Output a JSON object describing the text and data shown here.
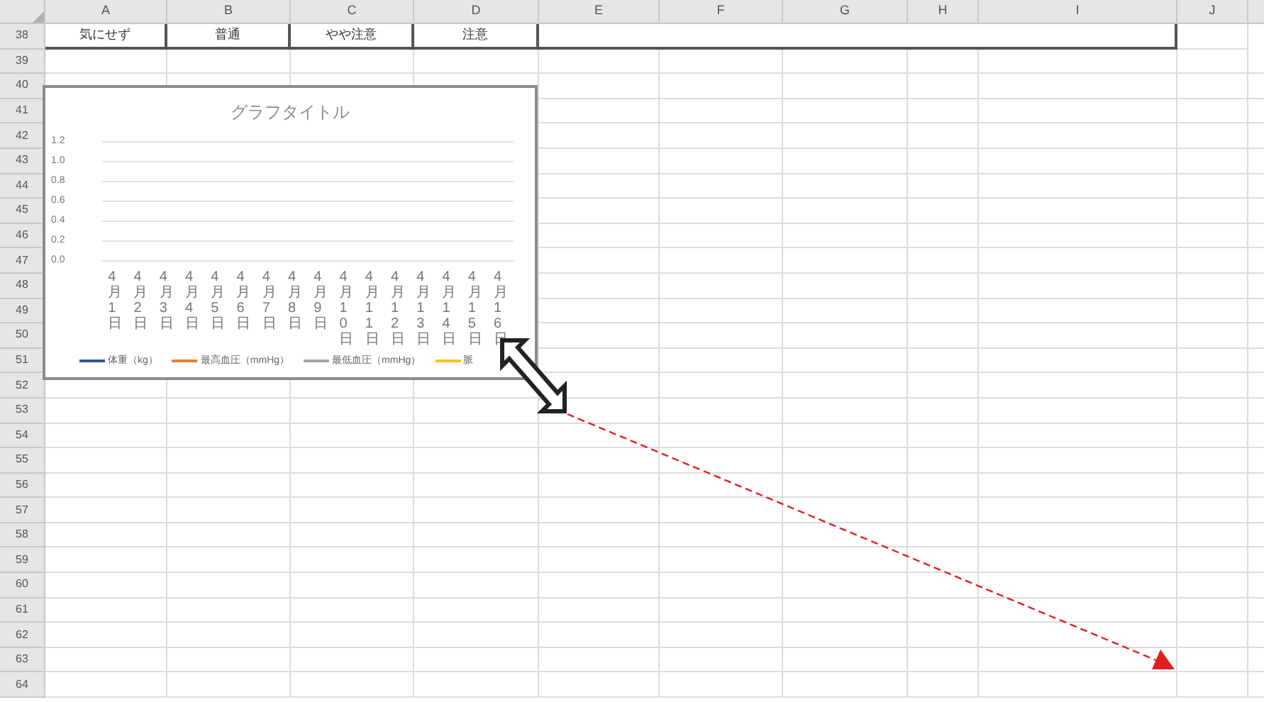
{
  "columns": [
    "A",
    "B",
    "C",
    "D",
    "E",
    "F",
    "G",
    "H",
    "I",
    "J"
  ],
  "rows": [
    "38",
    "39",
    "40",
    "41",
    "42",
    "43",
    "44",
    "45",
    "46",
    "47",
    "48",
    "49",
    "50",
    "51",
    "52",
    "53",
    "54",
    "55",
    "56",
    "57",
    "58",
    "59",
    "60",
    "61",
    "62",
    "63",
    "64"
  ],
  "header_row_cells": [
    "気にせず",
    "普通",
    "やや注意",
    "注意"
  ],
  "chart": {
    "chart_data": {
      "type": "line",
      "title": "グラフタイトル",
      "categories": [
        "4月1日",
        "4月2日",
        "4月3日",
        "4月4日",
        "4月5日",
        "4月6日",
        "4月7日",
        "4月8日",
        "4月9日",
        "4月10日",
        "4月11日",
        "4月12日",
        "4月13日",
        "4月14日",
        "4月15日",
        "4月16日"
      ],
      "yticks": [
        {
          "value": 0,
          "label": "0.0"
        },
        {
          "value": 0.2,
          "label": "0.2"
        },
        {
          "value": 0.4,
          "label": "0.4"
        },
        {
          "value": 0.6,
          "label": "0.6"
        },
        {
          "value": 0.8,
          "label": "0.8"
        },
        {
          "value": 1,
          "label": "1.0"
        },
        {
          "value": 1.2,
          "label": "1.2"
        }
      ],
      "ylim": [
        0,
        1.2
      ],
      "grid": true,
      "series": [
        {
          "name": "体重（kg）",
          "color": "#2f5597",
          "values": [
            null,
            null,
            null,
            null,
            null,
            null,
            null,
            null,
            null,
            null,
            null,
            null,
            null,
            null,
            null,
            null
          ]
        },
        {
          "name": "最高血圧（mmHg）",
          "color": "#ed7d31",
          "values": [
            null,
            null,
            null,
            null,
            null,
            null,
            null,
            null,
            null,
            null,
            null,
            null,
            null,
            null,
            null,
            null
          ]
        },
        {
          "name": "最低血圧（mmHg）",
          "color": "#a5a5a5",
          "values": [
            null,
            null,
            null,
            null,
            null,
            null,
            null,
            null,
            null,
            null,
            null,
            null,
            null,
            null,
            null,
            null
          ]
        },
        {
          "name": "脈",
          "color": "#ffc000",
          "values": [
            null,
            null,
            null,
            null,
            null,
            null,
            null,
            null,
            null,
            null,
            null,
            null,
            null,
            null,
            null,
            null
          ]
        }
      ]
    }
  }
}
